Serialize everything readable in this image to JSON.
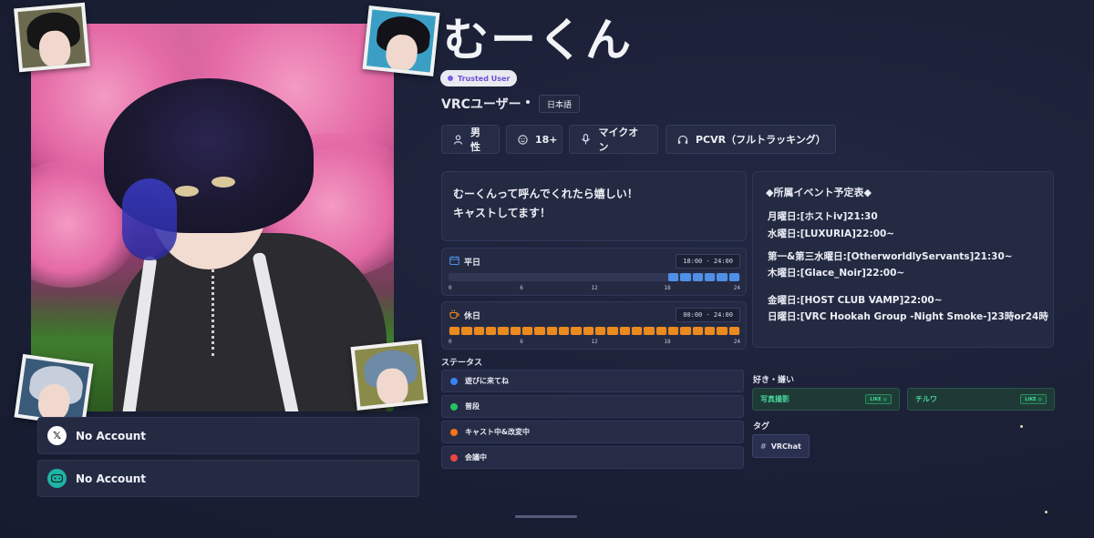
{
  "profile": {
    "name": "むーくん",
    "trust_badge": "Trusted User",
    "role": "VRCユーザー",
    "language": "日本語"
  },
  "attributes": [
    {
      "icon": "person-icon",
      "label": "男性"
    },
    {
      "icon": "age-icon",
      "label": "18+"
    },
    {
      "icon": "microphone-icon",
      "label": "マイクオン"
    },
    {
      "icon": "headset-icon",
      "label": "PCVR（フルトラッキング）"
    }
  ],
  "bio": {
    "line1": "むーくんって呼んでくれたら嬉しい！",
    "line2": "キャストしてます！"
  },
  "schedule": {
    "tick_labels": [
      "0",
      "6",
      "12",
      "18",
      "24"
    ],
    "weekday": {
      "icon": "calendar-icon",
      "label": "平日",
      "time": "18:00 - 24:00",
      "start": 18,
      "end": 24,
      "color": "#4f8fe8"
    },
    "holiday": {
      "icon": "coffee-icon",
      "label": "休日",
      "time": "00:00 - 24:00",
      "start": 0,
      "end": 24,
      "color": "#ec8a1c"
    }
  },
  "status": {
    "title": "ステータス",
    "items": [
      {
        "label": "遊びに来てね",
        "color": "#3b82f6"
      },
      {
        "label": "普段",
        "color": "#22c55e"
      },
      {
        "label": "キャスト中&改変中",
        "color": "#f97316"
      },
      {
        "label": "会議中",
        "color": "#ef4444"
      }
    ]
  },
  "events": {
    "title": "◆所属イベント予定表◆",
    "lines": [
      "月曜日:[ホストiv]21:30",
      "水曜日:[LUXURIA]22:00~",
      "第一&第三水曜日:[OtherworldlyServants]21:30~",
      "木曜日:[Glace_Noir]22:00~",
      "金曜日:[HOST CLUB VAMP]22:00~",
      "日曜日:[VRC Hookah Group -Night Smoke-]23時or24時"
    ]
  },
  "likes": {
    "title": "好き・嫌い",
    "items": [
      {
        "label": "写真撮影",
        "badge": "LIKE"
      },
      {
        "label": "チルワ",
        "badge": "LIKE"
      }
    ]
  },
  "tags": {
    "title": "タグ",
    "items": [
      {
        "label": "VRChat"
      }
    ]
  },
  "socials": [
    {
      "icon": "x-logo-icon",
      "label": "No Account",
      "color": "#ffffff"
    },
    {
      "icon": "gamepad-icon",
      "label": "No Account",
      "color": "#1fb3a5"
    }
  ]
}
